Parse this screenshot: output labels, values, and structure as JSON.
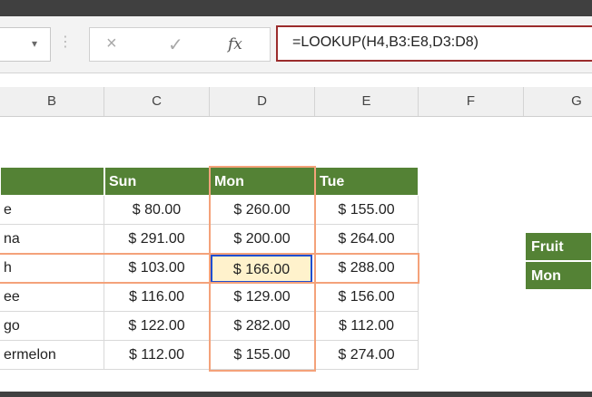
{
  "formula_bar": {
    "formula": "=LOOKUP(H4,B3:E8,D3:D8)",
    "cancel_icon": "×",
    "enter_icon": "✓",
    "fx_label": "fx",
    "dropdown_icon": "▾",
    "separator": "⋮"
  },
  "columns": [
    "B",
    "C",
    "D",
    "E",
    "F",
    "G"
  ],
  "table": {
    "headers": [
      "",
      "Sun",
      "Mon",
      "Tue"
    ],
    "rows": [
      {
        "fruit": "e",
        "sun": "$   80.00",
        "mon": "$ 260.00",
        "tue": "$ 155.00"
      },
      {
        "fruit": "na",
        "sun": "$ 291.00",
        "mon": "$ 200.00",
        "tue": "$ 264.00"
      },
      {
        "fruit": "h",
        "sun": "$ 103.00",
        "mon": "$ 166.00",
        "tue": "$ 288.00"
      },
      {
        "fruit": "ee",
        "sun": "$ 116.00",
        "mon": "$ 129.00",
        "tue": "$ 156.00"
      },
      {
        "fruit": "go",
        "sun": "$ 122.00",
        "mon": "$ 282.00",
        "tue": "$ 112.00"
      },
      {
        "fruit": "ermelon",
        "sun": "$ 112.00",
        "mon": "$ 155.00",
        "tue": "$ 274.00"
      }
    ]
  },
  "side_table": {
    "label1": "Fruit",
    "label2": "Mon"
  },
  "colors": {
    "header_green": "#548235",
    "highlight_orange": "#f4a27a",
    "active_cell_border": "#1f4fd1",
    "formula_border": "#9b2c2c"
  }
}
